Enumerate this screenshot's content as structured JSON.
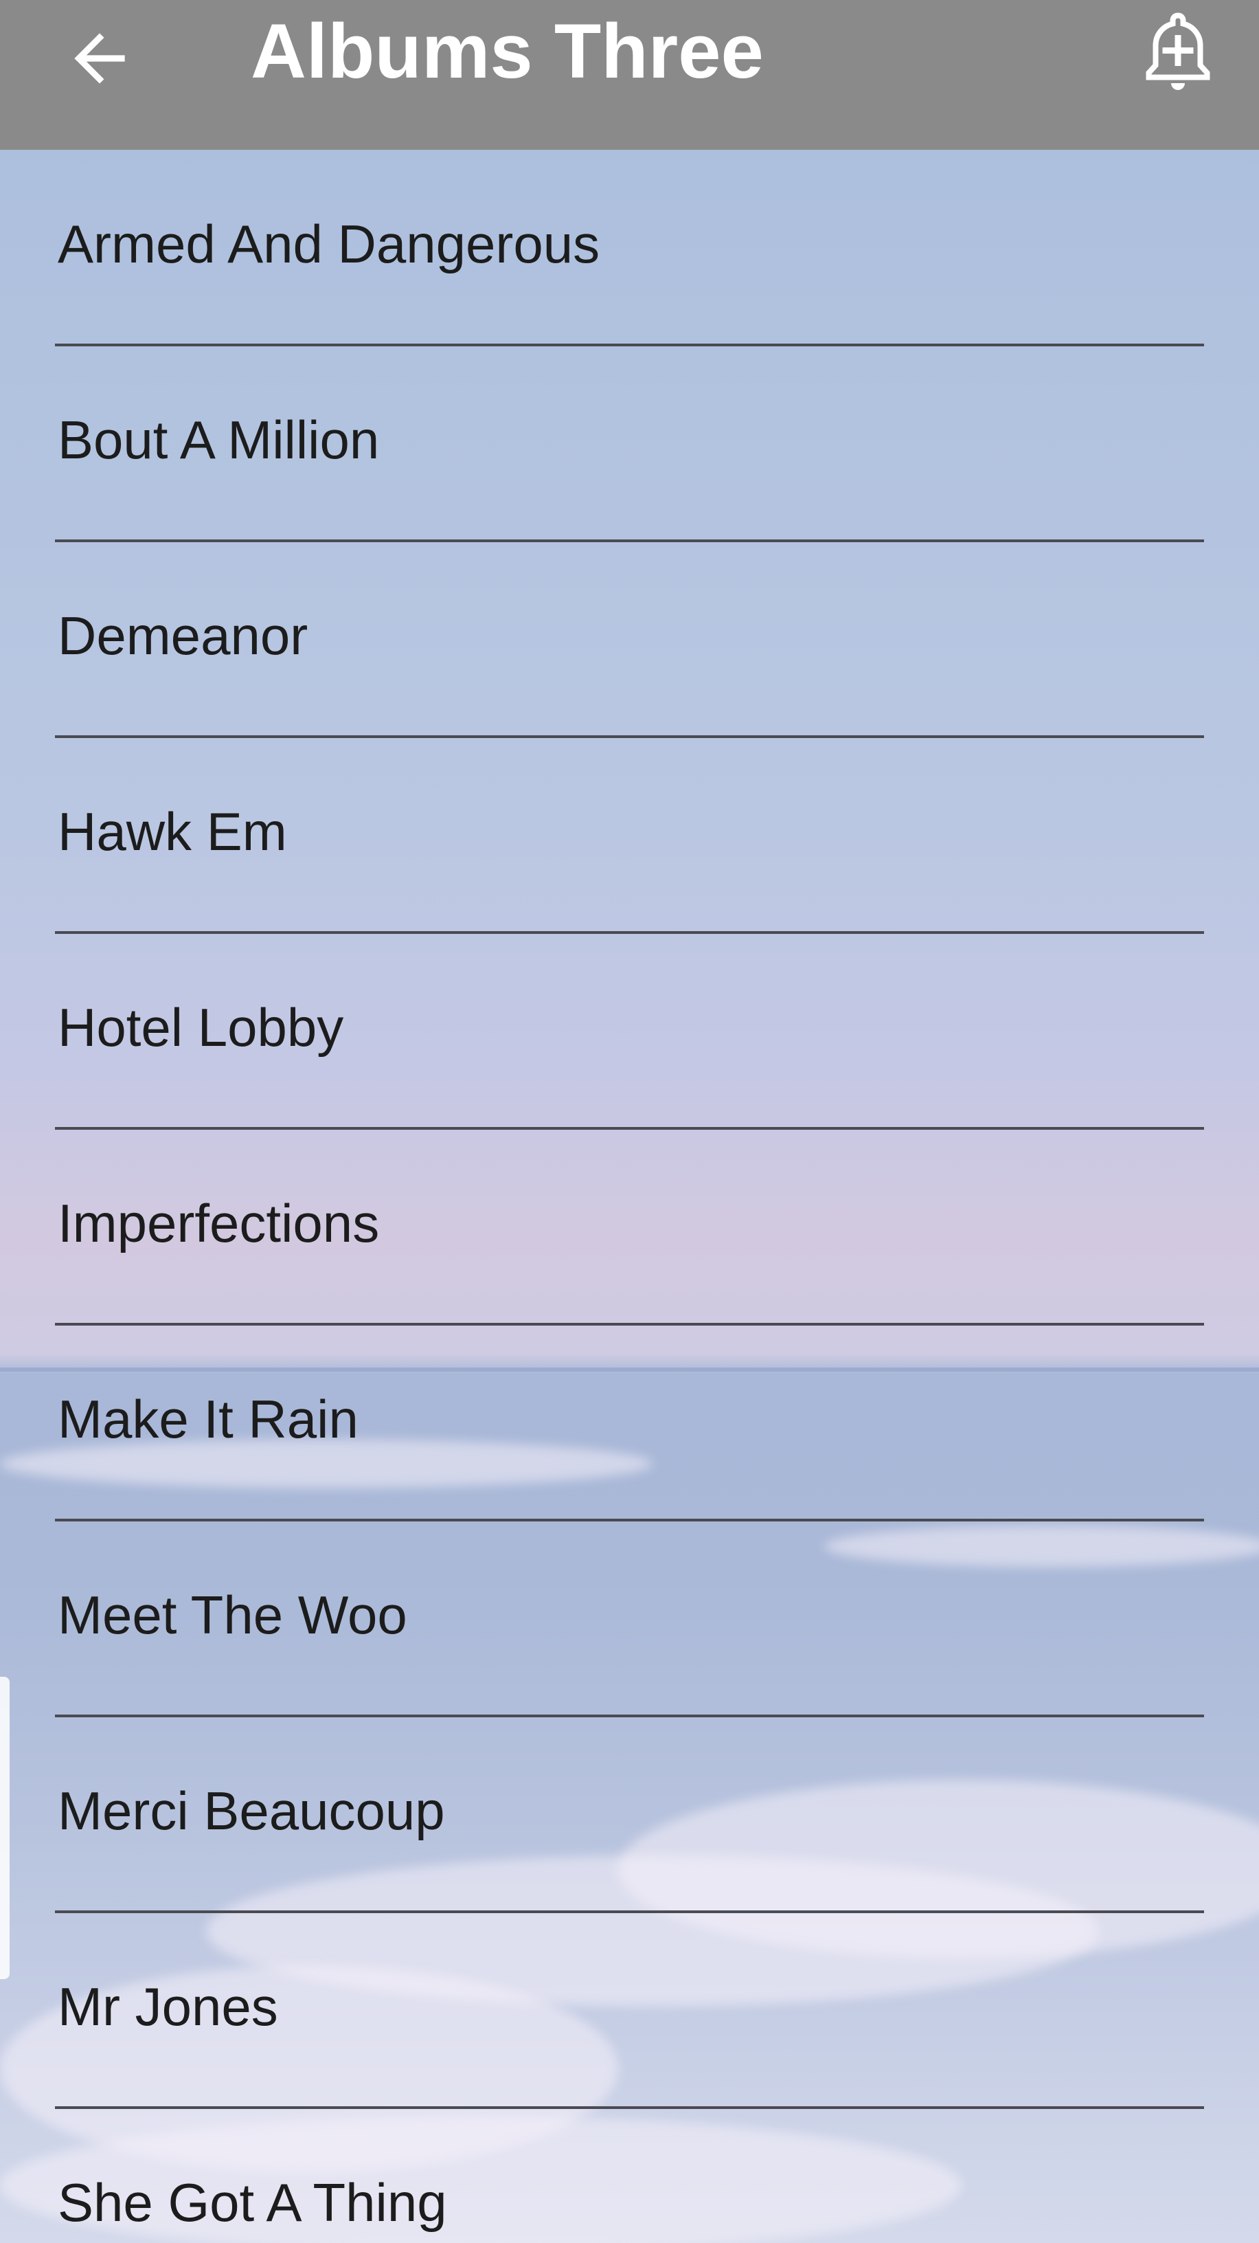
{
  "appbar": {
    "title": "Albums Three",
    "back_icon": "arrow-left-icon",
    "action_icon": "add-alert-icon",
    "background": "#8a8a8a"
  },
  "songs": [
    "Armed And Dangerous",
    "Bout A Million",
    "Demeanor",
    "Hawk Em",
    "Hotel Lobby",
    "Imperfections",
    "Make It Rain",
    "Meet The Woo",
    "Merci Beaucoup",
    "Mr Jones",
    "She Got A Thing"
  ]
}
